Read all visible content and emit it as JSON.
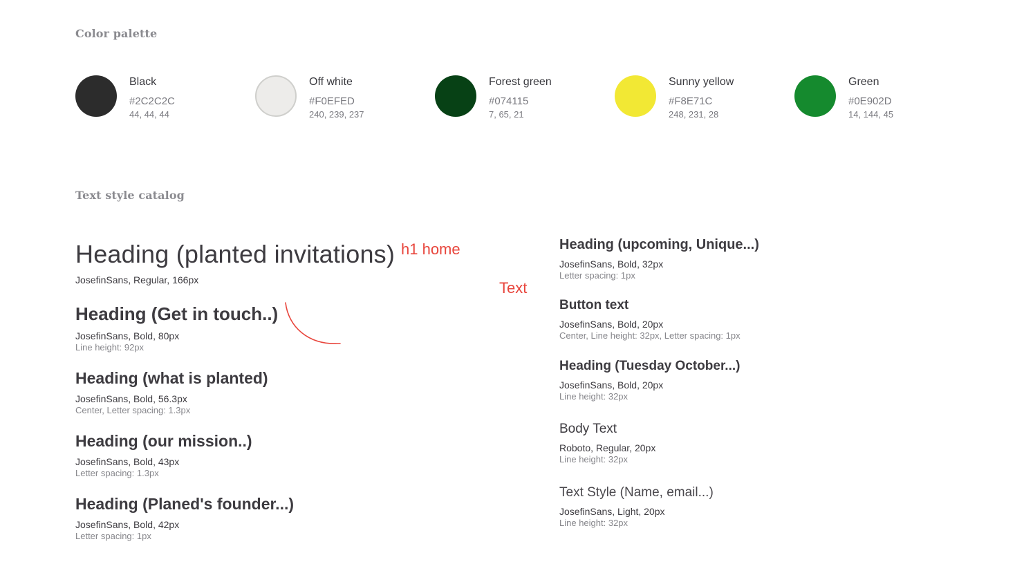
{
  "palette": {
    "title": "Color palette",
    "colors": [
      {
        "name": "Black",
        "hex": "#2C2C2C",
        "rgb": "44, 44, 44",
        "swatch": "#2c2c2c"
      },
      {
        "name": "Off white",
        "hex": "#F0EFED",
        "rgb": "240, 239, 237",
        "swatch": "#f0efed"
      },
      {
        "name": "Forest green",
        "hex": "#074115",
        "rgb": "7, 65, 21",
        "swatch": "#074115"
      },
      {
        "name": "Sunny yellow",
        "hex": "#F8E71C",
        "rgb": "248, 231, 28",
        "swatch": "#f2e834"
      },
      {
        "name": "Green",
        "hex": "#0E902D",
        "rgb": "14, 144, 45",
        "swatch": "#158a2e"
      }
    ]
  },
  "catalog": {
    "title": "Text style catalog",
    "left": [
      {
        "sample": "Heading (planted invitations)",
        "spec": "JosefinSans, Regular, 166px",
        "note": ""
      },
      {
        "sample": "Heading (Get in touch..)",
        "spec": "JosefinSans, Bold, 80px",
        "note": "Line height: 92px"
      },
      {
        "sample": "Heading (what is planted)",
        "spec": "JosefinSans, Bold, 56.3px",
        "note": "Center, Letter spacing: 1.3px"
      },
      {
        "sample": "Heading (our mission..)",
        "spec": "JosefinSans, Bold, 43px",
        "note": "Letter spacing: 1.3px"
      },
      {
        "sample": "Heading (Planed's founder...)",
        "spec": "JosefinSans, Bold, 42px",
        "note": "Letter spacing: 1px"
      }
    ],
    "right": [
      {
        "sample": "Heading (upcoming, Unique...)",
        "spec": "JosefinSans, Bold, 32px",
        "note": "Letter spacing: 1px"
      },
      {
        "sample": "Button text",
        "spec": "JosefinSans, Bold, 20px",
        "note": "Center, Line height: 32px, Letter spacing: 1px"
      },
      {
        "sample": "Heading (Tuesday October...)",
        "spec": "JosefinSans, Bold, 20px",
        "note": "Line height: 32px"
      },
      {
        "sample": "Body Text",
        "spec": "Roboto, Regular, 20px",
        "note": "Line height: 32px"
      },
      {
        "sample": "Text Style (Name, email...)",
        "spec": "JosefinSans, Light, 20px",
        "note": "Line height: 32px"
      }
    ]
  },
  "annotations": {
    "h1_home": "h1 home",
    "text": "Text",
    "color": "#e8453c"
  }
}
